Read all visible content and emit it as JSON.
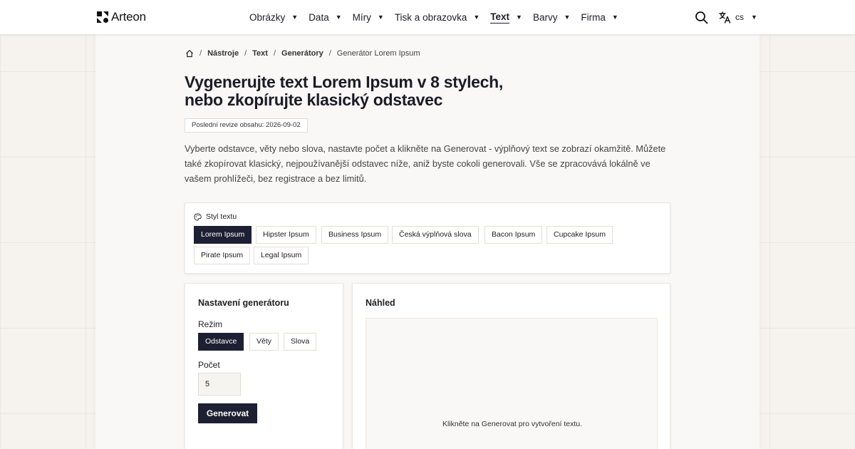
{
  "header": {
    "brand": "Arteon",
    "nav": [
      {
        "label": "Obrázky",
        "active": false
      },
      {
        "label": "Data",
        "active": false
      },
      {
        "label": "Míry",
        "active": false
      },
      {
        "label": "Tisk a obrazovka",
        "active": false
      },
      {
        "label": "Text",
        "active": true
      },
      {
        "label": "Barvy",
        "active": false
      },
      {
        "label": "Firma",
        "active": false
      }
    ],
    "language": "cs",
    "icons": {
      "search": "search-icon",
      "language": "translate-icon",
      "home": "home-icon",
      "style": "palette-icon"
    }
  },
  "breadcrumb": {
    "items": [
      "Nástroje",
      "Text",
      "Generátory"
    ],
    "current": "Generátor Lorem Ipsum"
  },
  "page": {
    "title_line1": "Vygenerujte text Lorem Ipsum v 8 stylech,",
    "title_line2": "nebo zkopírujte klasický odstavec",
    "revision": "Poslední revize obsahu: 2026-09-02",
    "intro": "Vyberte odstavce, věty nebo slova, nastavte počet a klikněte na Generovat - výplňový text se zobrazí okamžitě. Můžete také zkopírovat klasický, nejpoužívanější odstavec níže, aniž byste cokoli generovali. Vše se zpracovává lokálně ve vašem prohlížeči, bez registrace a bez limitů."
  },
  "style_picker": {
    "label": "Styl textu",
    "options": [
      {
        "label": "Lorem Ipsum",
        "selected": true
      },
      {
        "label": "Hipster Ipsum",
        "selected": false
      },
      {
        "label": "Business Ipsum",
        "selected": false
      },
      {
        "label": "Česká výplňová slova",
        "selected": false
      },
      {
        "label": "Bacon Ipsum",
        "selected": false
      },
      {
        "label": "Cupcake Ipsum",
        "selected": false
      },
      {
        "label": "Pirate Ipsum",
        "selected": false
      },
      {
        "label": "Legal Ipsum",
        "selected": false
      }
    ]
  },
  "settings": {
    "heading": "Nastavení generátoru",
    "mode_label": "Režim",
    "modes": [
      {
        "label": "Odstavce",
        "selected": true
      },
      {
        "label": "Věty",
        "selected": false
      },
      {
        "label": "Slova",
        "selected": false
      }
    ],
    "count_label": "Počet",
    "count_value": "5",
    "generate_label": "Generovat"
  },
  "preview": {
    "heading": "Náhled",
    "empty_text": "Klikněte na Generovat pro vytvoření textu."
  },
  "colors": {
    "accent": "#1d1f33",
    "background": "#f6f2ee"
  }
}
